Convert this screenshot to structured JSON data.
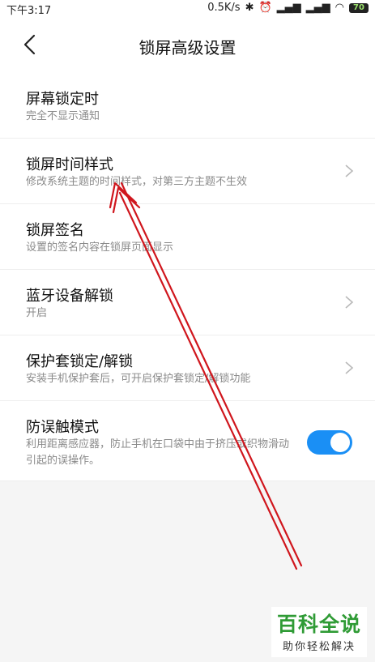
{
  "status_bar": {
    "time": "下午3:17",
    "speed": "0.5K/s",
    "battery": "70"
  },
  "header": {
    "title": "锁屏高级设置"
  },
  "items": [
    {
      "title": "屏幕锁定时",
      "subtitle": "完全不显示通知"
    },
    {
      "title": "锁屏时间样式",
      "subtitle": "修改系统主题的时间样式，对第三方主题不生效"
    },
    {
      "title": "锁屏签名",
      "subtitle": "设置的签名内容在锁屏页面显示"
    },
    {
      "title": "蓝牙设备解锁",
      "subtitle": "开启"
    },
    {
      "title": "保护套锁定/解锁",
      "subtitle": "安装手机保护套后，可开启保护套锁定/解锁功能"
    },
    {
      "title": "防误触模式",
      "subtitle": "利用距离感应器，防止手机在口袋中由于挤压或织物滑动引起的误操作。",
      "toggle_on": true
    }
  ],
  "watermark": {
    "brand": "百科全说",
    "tagline": "助你轻松解决"
  },
  "colors": {
    "accent": "#1a8ff5",
    "annotation": "#d0161d",
    "brand": "#2f9b35"
  }
}
